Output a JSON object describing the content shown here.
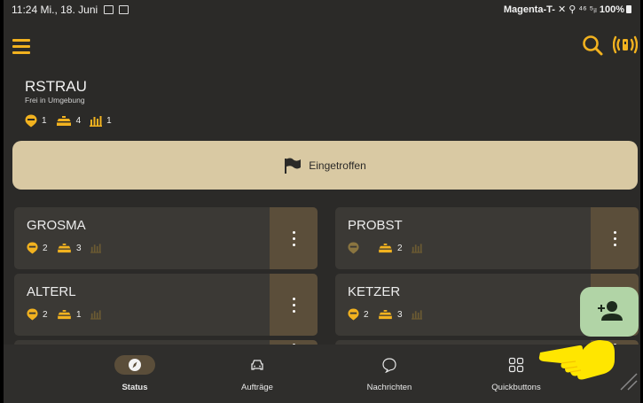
{
  "status_bar": {
    "time_date": "11:24 Mi., 18. Juni",
    "carrier": "Magenta-T-",
    "signal": "⁴⁶ ⁵ᵢₗ",
    "battery": "100%"
  },
  "header": {
    "vehicle_name": "RSTRAU",
    "vehicle_status": "Frei in Umgebung",
    "stats": {
      "pins": "1",
      "taxis": "4",
      "bars": "1"
    }
  },
  "arrived_button": {
    "label": "Eingetroffen"
  },
  "cards": [
    {
      "name": "GROSMA",
      "pins": "2",
      "taxis": "3",
      "pin_active": true
    },
    {
      "name": "PROBST",
      "pins": "",
      "taxis": "2",
      "pin_active": false
    },
    {
      "name": "ALTERL",
      "pins": "2",
      "taxis": "1",
      "pin_active": true
    },
    {
      "name": "KETZER",
      "pins": "2",
      "taxis": "3",
      "pin_active": true
    }
  ],
  "nav": [
    {
      "label": "Status",
      "icon": "compass-icon",
      "active": true
    },
    {
      "label": "Aufträge",
      "icon": "car-icon",
      "active": false
    },
    {
      "label": "Nachrichten",
      "icon": "chat-bubble-icon",
      "active": false
    },
    {
      "label": "Quickbuttons",
      "icon": "grid-icon",
      "active": false
    }
  ],
  "colors": {
    "accent": "#f2b21f",
    "background": "#2b2a28",
    "card": "#3b3935",
    "card_menu": "#5b4e3a",
    "arrived_button": "#d9c9a3",
    "fab": "#b1d4a6",
    "pointer_hand": "#ffe600"
  },
  "icons": {
    "menu": "hamburger-menu-icon",
    "search": "search-icon",
    "radio": "radio-signal-icon",
    "fab": "add-person-icon",
    "arrived": "flag-icon"
  }
}
